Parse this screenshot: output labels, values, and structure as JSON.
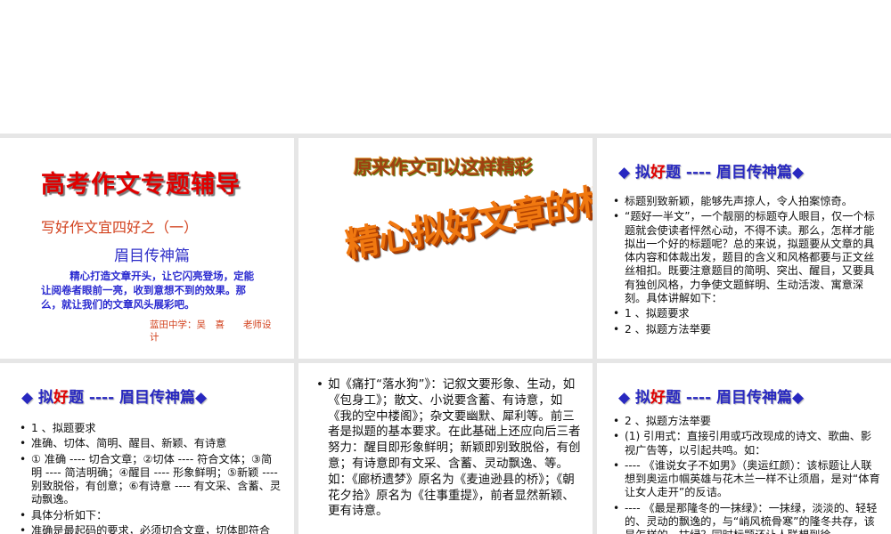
{
  "slides": [
    {
      "title": "高考作文专题辅导",
      "subtitle": "写好作文宜四好之（一）",
      "heading": "眉目传神篇",
      "paragraph": "精心打造文章开头，让它闪亮登场，定能让阅卷者眼前一亮，收到意想不到的效果。那么，就让我们的文章风头展彩吧。",
      "author": "蓝田中学：吴　喜　　老师设计"
    },
    {
      "wordart_top": "原来作文可以这样精彩",
      "wordart_main": "精心拟好文章的标题"
    },
    {
      "header": {
        "prefix": "◆ 拟",
        "red": "好",
        "suffix": "题 ---- 眉目传神篇◆"
      },
      "bullets": [
        "标题别致新颖，能够先声掠人，令人拍案惊奇。",
        "“题好一半文”，一个靓丽的标题夺人眼目，仅一个标题就会使读者怦然心动，不得不读。那么，怎样才能拟出一个好的标题呢？总的来说，拟题要从文章的具体内容和体裁出发，题目的含义和风格都要与正文丝丝相扣。既要注意题目的简明、突出、醒目，又要具有独创风格，力争使文题鲜明、生动活泼、寓意深刻。具体讲解如下：",
        "1 、拟题要求",
        "2 、拟题方法举要"
      ]
    },
    {
      "header": {
        "prefix": "◆ 拟",
        "red": "好",
        "suffix": "题 ---- 眉目传神篇◆"
      },
      "bullets": [
        "1 、拟题要求",
        "准确、切体、简明、醒目、新颖、有诗意",
        "① 准确 ---- 切合文章；②切体 ---- 符合文体；③简明 ---- 简洁明确；④醒目 ---- 形象鲜明；⑤新颖 ---- 别致脱俗，有创意；⑥有诗意 ---- 有文采、含蓄、灵动飘逸。",
        "具体分析如下：",
        "准确是最起码的要求，必须切合文章，切体即符合"
      ]
    },
    {
      "bullets": [
        "如《痛打“落水狗”》：记叙文要形象、生动，如《包身工》；散文、小说要含蓄、有诗意，如《我的空中楼阁》；杂文要幽默、犀利等。前三者是拟题的基本要求。在此基础上还应向后三者努力：醒目即形象鲜明；新颖即别致脱俗，有创意；有诗意即有文采、含蓄、灵动飘逸、等。如：《廊桥遗梦》原名为《麦迪逊县的桥》；《朝花夕拾》原名为《往事重提》，前者显然新颖、更有诗意。"
      ]
    },
    {
      "header": {
        "prefix": "◆ 拟",
        "red": "好",
        "suffix": "题 ---- 眉目传神篇◆"
      },
      "bullets": [
        "2 、拟题方法举要",
        "(1) 引用式：直接引用或巧改现成的诗文、歌曲、影视广告等，以引起共鸣。如：",
        "---- 《谁说女子不如男》（奥运红颜）：该标题让人联想到奥运巾帼英雄与花木兰一样不让须眉，是对“体育让女人走开”的反诘。",
        "---- 《最是那隆冬的一抹绿》：一抹绿，淡淡的、轻轻的、灵动的飘逸的，与“峭风梳骨寒”的隆冬共存，该是怎样的一抹绿？同时标题还让人联想到徐"
      ]
    }
  ]
}
